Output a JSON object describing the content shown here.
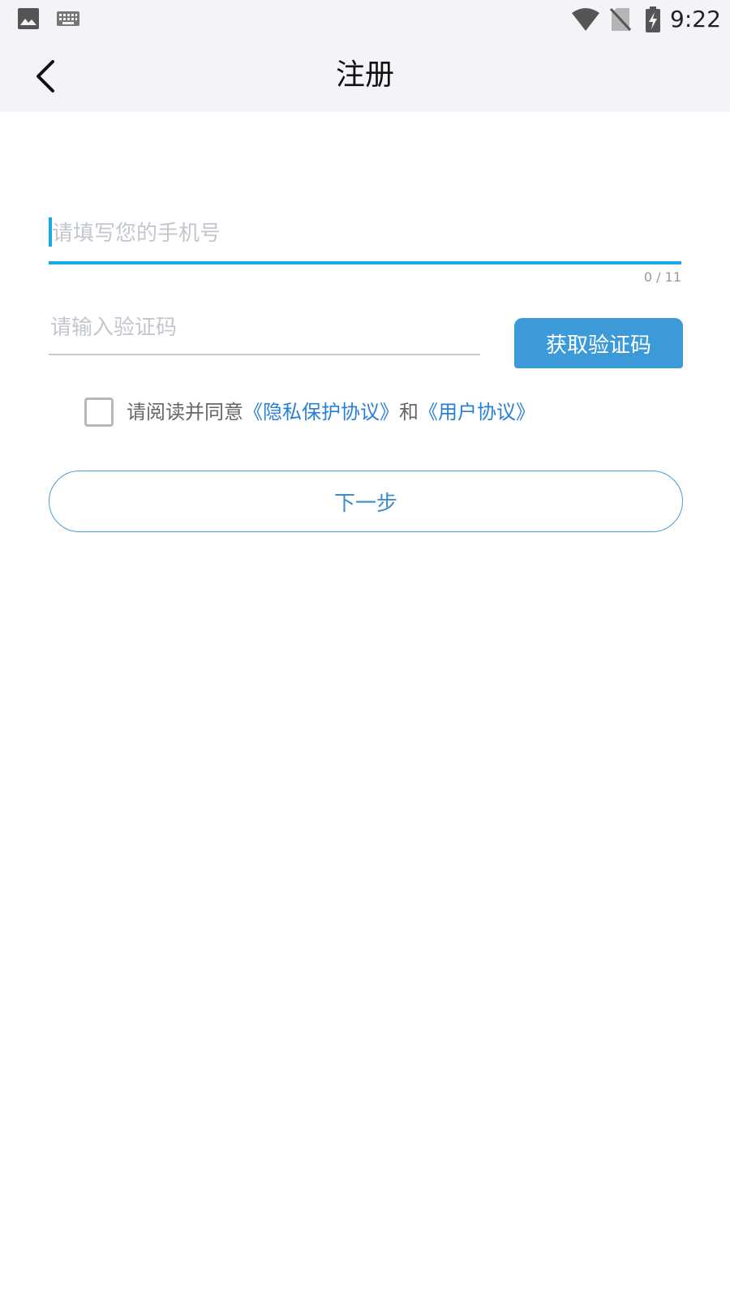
{
  "status_bar": {
    "time": "9:22",
    "icons": [
      "gallery-icon",
      "keyboard-icon",
      "wifi-icon",
      "no-sim-icon",
      "battery-charging-icon"
    ]
  },
  "app_bar": {
    "title": "注册",
    "back_icon": "chevron-left-icon"
  },
  "form": {
    "phone": {
      "value": "",
      "placeholder": "请填写您的手机号",
      "counter": "0 / 11"
    },
    "code": {
      "value": "",
      "placeholder": "请输入验证码"
    },
    "get_code_label": "获取验证码",
    "agreement": {
      "checked": false,
      "prefix": "请阅读并同意",
      "privacy_link": "《隐私保护协议》",
      "joiner": "和",
      "user_link": "《用户协议》"
    },
    "next_label": "下一步"
  },
  "colors": {
    "accent": "#1aa9e6",
    "button_blue": "#3d9ad8",
    "link": "#2a7fd6",
    "bar_bg": "#f4f4f8"
  }
}
